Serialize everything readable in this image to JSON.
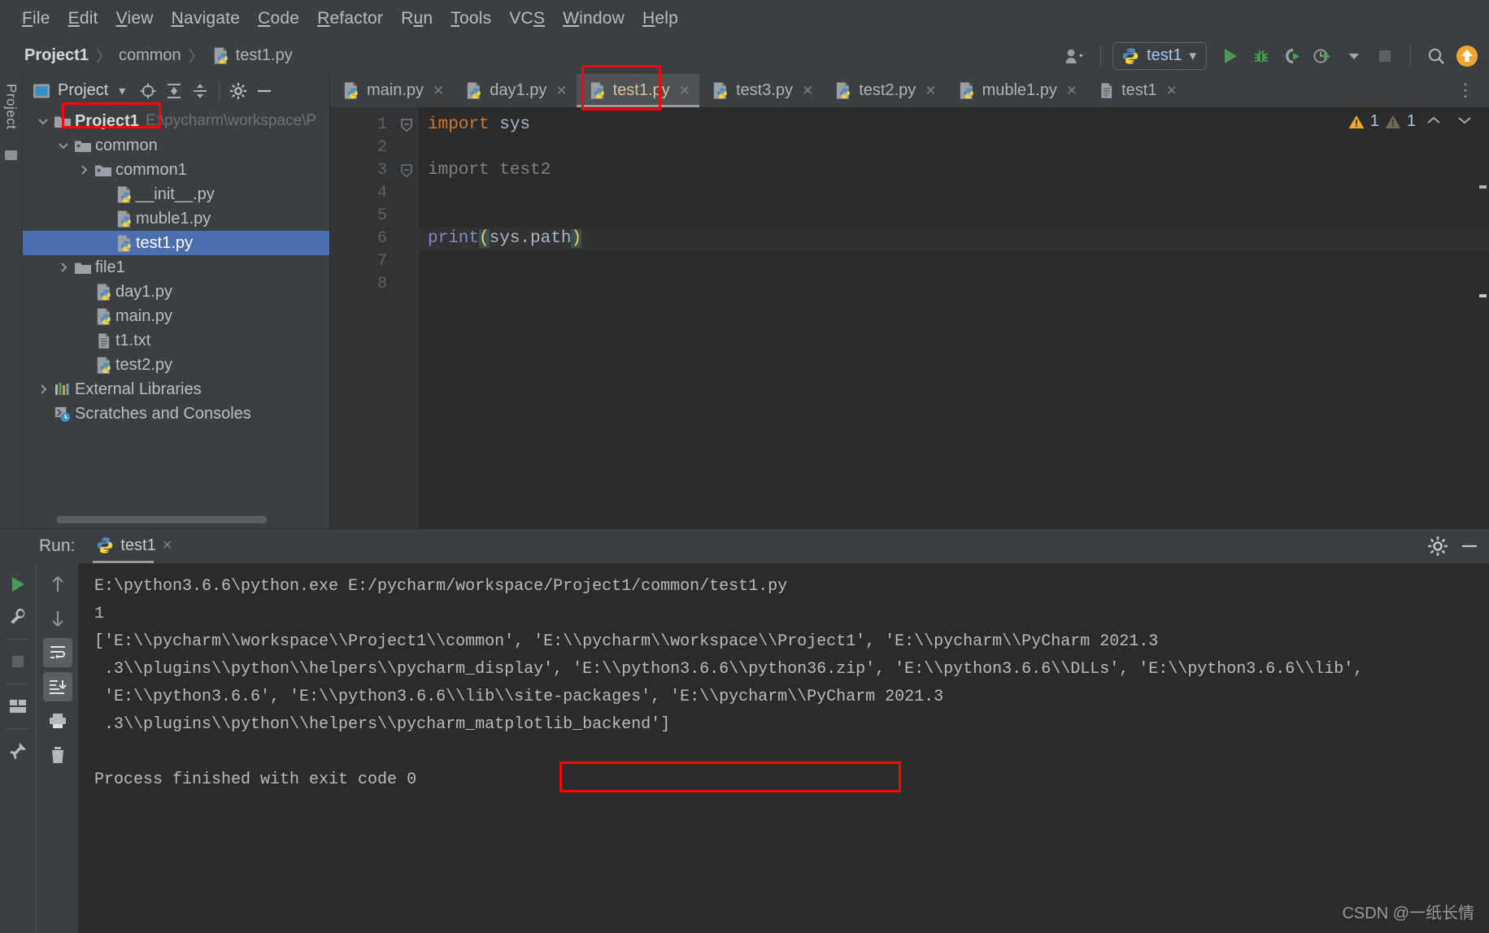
{
  "app": {
    "theme_bg": "#3c3f41",
    "editor_bg": "#2b2b2b",
    "accent_selection": "#4b6eaf",
    "annotation_color": "#ff0000",
    "watermark": "CSDN @一纸长情"
  },
  "menubar": {
    "items": [
      {
        "label": "File",
        "mnemonic": "F"
      },
      {
        "label": "Edit",
        "mnemonic": "E"
      },
      {
        "label": "View",
        "mnemonic": "V"
      },
      {
        "label": "Navigate",
        "mnemonic": "N"
      },
      {
        "label": "Code",
        "mnemonic": "C"
      },
      {
        "label": "Refactor",
        "mnemonic": "R"
      },
      {
        "label": "Run",
        "mnemonic": "u"
      },
      {
        "label": "Tools",
        "mnemonic": "T"
      },
      {
        "label": "VCS",
        "mnemonic": "S"
      },
      {
        "label": "Window",
        "mnemonic": "W"
      },
      {
        "label": "Help",
        "mnemonic": "H"
      }
    ]
  },
  "navbar": {
    "breadcrumbs": [
      {
        "label": "Project1",
        "icon": "none"
      },
      {
        "label": "common",
        "icon": "none"
      },
      {
        "label": "test1.py",
        "icon": "python-file-icon"
      }
    ],
    "separator": "〉",
    "run_config": {
      "label": "test1",
      "icon": "python-icon",
      "dropdown_arrow": "▾"
    },
    "buttons": [
      {
        "name": "account-icon",
        "label": ""
      },
      {
        "name": "run-button",
        "label": ""
      },
      {
        "name": "debug-button",
        "label": ""
      },
      {
        "name": "run-with-coverage-button",
        "label": ""
      },
      {
        "name": "profile-button",
        "label": ""
      },
      {
        "name": "stop-button",
        "label": ""
      },
      {
        "name": "search-everywhere-button",
        "label": ""
      },
      {
        "name": "updates-available-button",
        "label": ""
      }
    ]
  },
  "left_strip": {
    "label": "Project"
  },
  "project_window": {
    "title": "Project",
    "dropdown_arrow": "▾",
    "header_buttons": [
      {
        "name": "locate-in-tree-icon"
      },
      {
        "name": "expand-all-icon"
      },
      {
        "name": "collapse-all-icon"
      },
      {
        "name": "settings-gear-icon"
      },
      {
        "name": "hide-window-icon"
      }
    ],
    "tree": [
      {
        "label": "Project1",
        "path_hint": "E:\\pycharm\\workspace\\P",
        "indent": 0,
        "twisty": "expanded",
        "icon": "folder-icon",
        "bold": true,
        "selected": false,
        "annotated": true
      },
      {
        "label": "common",
        "path_hint": "",
        "indent": 1,
        "twisty": "expanded",
        "icon": "package-folder-icon",
        "bold": false,
        "selected": false,
        "annotated": false
      },
      {
        "label": "common1",
        "path_hint": "",
        "indent": 2,
        "twisty": "collapsed",
        "icon": "package-folder-icon",
        "bold": false,
        "selected": false,
        "annotated": false
      },
      {
        "label": "__init__.py",
        "path_hint": "",
        "indent": 3,
        "twisty": "none",
        "icon": "python-file-icon",
        "bold": false,
        "selected": false,
        "annotated": false
      },
      {
        "label": "muble1.py",
        "path_hint": "",
        "indent": 3,
        "twisty": "none",
        "icon": "python-file-icon",
        "bold": false,
        "selected": false,
        "annotated": false
      },
      {
        "label": "test1.py",
        "path_hint": "",
        "indent": 3,
        "twisty": "none",
        "icon": "python-file-icon",
        "bold": false,
        "selected": true,
        "annotated": false
      },
      {
        "label": "file1",
        "path_hint": "",
        "indent": 1,
        "twisty": "collapsed",
        "icon": "folder-icon",
        "bold": false,
        "selected": false,
        "annotated": false
      },
      {
        "label": "day1.py",
        "path_hint": "",
        "indent": 2,
        "twisty": "none",
        "icon": "python-file-icon",
        "bold": false,
        "selected": false,
        "annotated": false
      },
      {
        "label": "main.py",
        "path_hint": "",
        "indent": 2,
        "twisty": "none",
        "icon": "python-file-icon",
        "bold": false,
        "selected": false,
        "annotated": false
      },
      {
        "label": "t1.txt",
        "path_hint": "",
        "indent": 2,
        "twisty": "none",
        "icon": "text-file-icon",
        "bold": false,
        "selected": false,
        "annotated": false
      },
      {
        "label": "test2.py",
        "path_hint": "",
        "indent": 2,
        "twisty": "none",
        "icon": "python-file-icon",
        "bold": false,
        "selected": false,
        "annotated": false
      },
      {
        "label": "External Libraries",
        "path_hint": "",
        "indent": 0,
        "twisty": "collapsed",
        "icon": "external-libraries-icon",
        "bold": false,
        "selected": false,
        "annotated": false
      },
      {
        "label": "Scratches and Consoles",
        "path_hint": "",
        "indent": 0,
        "twisty": "none",
        "icon": "scratches-icon",
        "bold": false,
        "selected": false,
        "annotated": false
      }
    ]
  },
  "editor": {
    "tabs": [
      {
        "label": "main.py",
        "icon": "python-file-icon",
        "active": false,
        "annotated": false
      },
      {
        "label": "day1.py",
        "icon": "python-file-icon",
        "active": false,
        "annotated": false
      },
      {
        "label": "test1.py",
        "icon": "python-file-icon",
        "active": true,
        "annotated": true
      },
      {
        "label": "test3.py",
        "icon": "python-file-icon",
        "active": false,
        "annotated": false
      },
      {
        "label": "test2.py",
        "icon": "python-file-icon",
        "active": false,
        "annotated": false
      },
      {
        "label": "muble1.py",
        "icon": "python-file-icon",
        "active": false,
        "annotated": false
      },
      {
        "label": "test1",
        "icon": "text-file-icon",
        "active": false,
        "annotated": false
      }
    ],
    "close_glyph": "×",
    "tabs_overflow_glyph": "⋮",
    "line_numbers": [
      "1",
      "2",
      "3",
      "4",
      "5",
      "6",
      "7",
      "8"
    ],
    "lines": [
      {
        "n": 1,
        "fold": "collapse",
        "segments": [
          {
            "t": "import",
            "c": "kw"
          },
          {
            "t": " sys",
            "c": "mod"
          }
        ],
        "caret": false
      },
      {
        "n": 2,
        "fold": "none",
        "segments": [],
        "caret": false
      },
      {
        "n": 3,
        "fold": "collapse-dim",
        "segments": [
          {
            "t": "import test2",
            "c": "dim"
          }
        ],
        "caret": false
      },
      {
        "n": 4,
        "fold": "none",
        "segments": [],
        "caret": false
      },
      {
        "n": 5,
        "fold": "none",
        "segments": [],
        "caret": false
      },
      {
        "n": 6,
        "fold": "none",
        "segments": [
          {
            "t": "print",
            "c": "fn"
          },
          {
            "t": "(",
            "c": "paren"
          },
          {
            "t": "sys.path",
            "c": "ident"
          },
          {
            "t": ")",
            "c": "paren"
          }
        ],
        "caret": true
      },
      {
        "n": 7,
        "fold": "none",
        "segments": [],
        "caret": false
      },
      {
        "n": 8,
        "fold": "none",
        "segments": [],
        "caret": false
      }
    ],
    "inspections": {
      "warning_count": "1",
      "weak_warning_count": "1",
      "prev_glyph": "⌃",
      "next_glyph": "⌄"
    }
  },
  "run_window": {
    "title": "Run:",
    "tab_label": "test1",
    "tab_icon": "python-icon",
    "close_glyph": "×",
    "header_buttons": [
      {
        "name": "settings-gear-icon"
      },
      {
        "name": "hide-window-icon"
      }
    ],
    "left_toolbar": [
      {
        "name": "rerun-button"
      },
      {
        "name": "wrench-settings-button"
      },
      {
        "name": "stop-process-button"
      },
      {
        "name": "layout-button"
      },
      {
        "name": "pin-tab-button"
      }
    ],
    "right_toolbar": [
      {
        "name": "scroll-up-button"
      },
      {
        "name": "scroll-down-button"
      },
      {
        "name": "soft-wrap-button"
      },
      {
        "name": "scroll-to-end-button"
      },
      {
        "name": "print-button"
      },
      {
        "name": "clear-all-button"
      }
    ],
    "console": {
      "lines": [
        {
          "text": "E:\\python3.6.6\\python.exe E:/pycharm/workspace/Project1/common/test1.py",
          "indent": false
        },
        {
          "text": "1",
          "indent": false
        },
        {
          "text": "['E:\\\\pycharm\\\\workspace\\\\Project1\\\\common', 'E:\\\\pycharm\\\\workspace\\\\Project1', 'E:\\\\pycharm\\\\PyCharm 2021.3",
          "indent": false,
          "annotated_segment": "'E:\\\\pycharm\\\\workspace\\\\Project1'"
        },
        {
          "text": ".3\\\\plugins\\\\python\\\\helpers\\\\pycharm_display', 'E:\\\\python3.6.6\\\\python36.zip', 'E:\\\\python3.6.6\\\\DLLs', 'E:\\\\python3.6.6\\\\lib',",
          "indent": true
        },
        {
          "text": "'E:\\\\python3.6.6', 'E:\\\\python3.6.6\\\\lib\\\\site-packages', 'E:\\\\pycharm\\\\PyCharm 2021.3",
          "indent": true
        },
        {
          "text": ".3\\\\plugins\\\\python\\\\helpers\\\\pycharm_matplotlib_backend']",
          "indent": true
        },
        {
          "text": "",
          "indent": false
        },
        {
          "text": "Process finished with exit code 0",
          "indent": false
        }
      ]
    }
  }
}
